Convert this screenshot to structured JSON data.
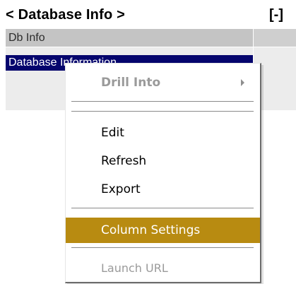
{
  "header": {
    "title": "< Database Info >",
    "collapse_label": "[-]"
  },
  "panel": {
    "header_row": "Db Info",
    "selected_row": "Database Information"
  },
  "context_menu": {
    "items": [
      {
        "label": "Drill Into",
        "state": "disabled",
        "has_submenu": true
      },
      {
        "label": "Edit",
        "state": "enabled"
      },
      {
        "label": "Refresh",
        "state": "enabled"
      },
      {
        "label": "Export",
        "state": "enabled"
      },
      {
        "label": "Column Settings",
        "state": "highlighted"
      },
      {
        "label": "Launch URL",
        "state": "disabled"
      }
    ]
  },
  "colors": {
    "selection_bg": "#05056d",
    "menu_highlight": "#b88b11",
    "panel_bg": "#ececec",
    "header_row_bg": "#c4c4c4"
  }
}
